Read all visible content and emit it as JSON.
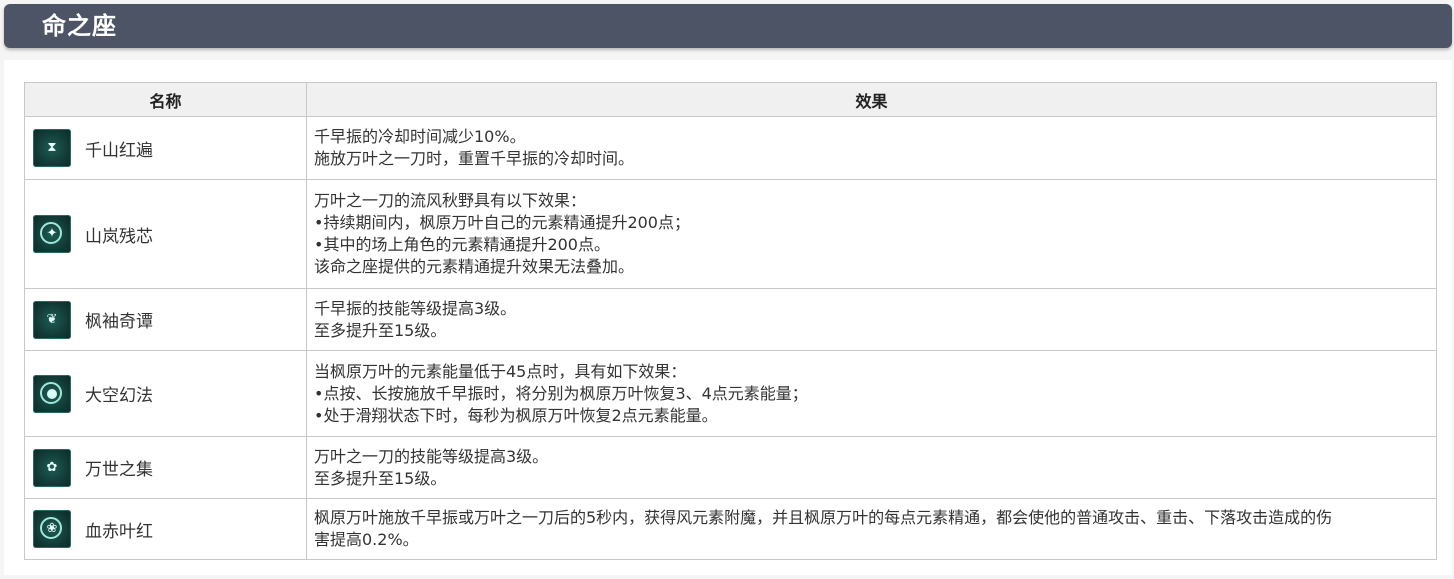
{
  "header": {
    "title": "命之座"
  },
  "table": {
    "columns": [
      "名称",
      "效果"
    ],
    "rows": [
      {
        "name": "千山红遍",
        "icon": "hourglass-icon",
        "effect": [
          "千早振的冷却时间减少10%。",
          "施放万叶之一刀时，重置千早振的冷却时间。"
        ]
      },
      {
        "name": "山岚残芯",
        "icon": "wind-swirl-icon",
        "effect": [
          "万叶之一刀的流风秋野具有以下效果：",
          "•持续期间内，枫原万叶自己的元素精通提升200点；",
          "•其中的场上角色的元素精通提升200点。",
          "该命之座提供的元素精通提升效果无法叠加。"
        ]
      },
      {
        "name": "枫袖奇谭",
        "icon": "leaf-swirl-icon",
        "effect": [
          "千早振的技能等级提高3级。",
          "至多提升至15级。"
        ]
      },
      {
        "name": "大空幻法",
        "icon": "wind-orb-icon",
        "effect": [
          "当枫原万叶的元素能量低于45点时，具有如下效果：",
          "•点按、长按施放千早振时，将分别为枫原万叶恢复3、4点元素能量；",
          "•处于滑翔状态下时，每秒为枫原万叶恢复2点元素能量。"
        ]
      },
      {
        "name": "万世之集",
        "icon": "maple-leaf-icon",
        "effect": [
          "万叶之一刀的技能等级提高3级。",
          "至多提升至15级。"
        ]
      },
      {
        "name": "血赤叶红",
        "icon": "crimson-leaf-icon",
        "effect": [
          "枫原万叶施放千早振或万叶之一刀后的5秒内，获得风元素附魔，并且枫原万叶的每点元素精通，都会使他的普通攻击、重击、下落攻击造成的伤",
          "害提高0.2%。"
        ]
      }
    ]
  }
}
